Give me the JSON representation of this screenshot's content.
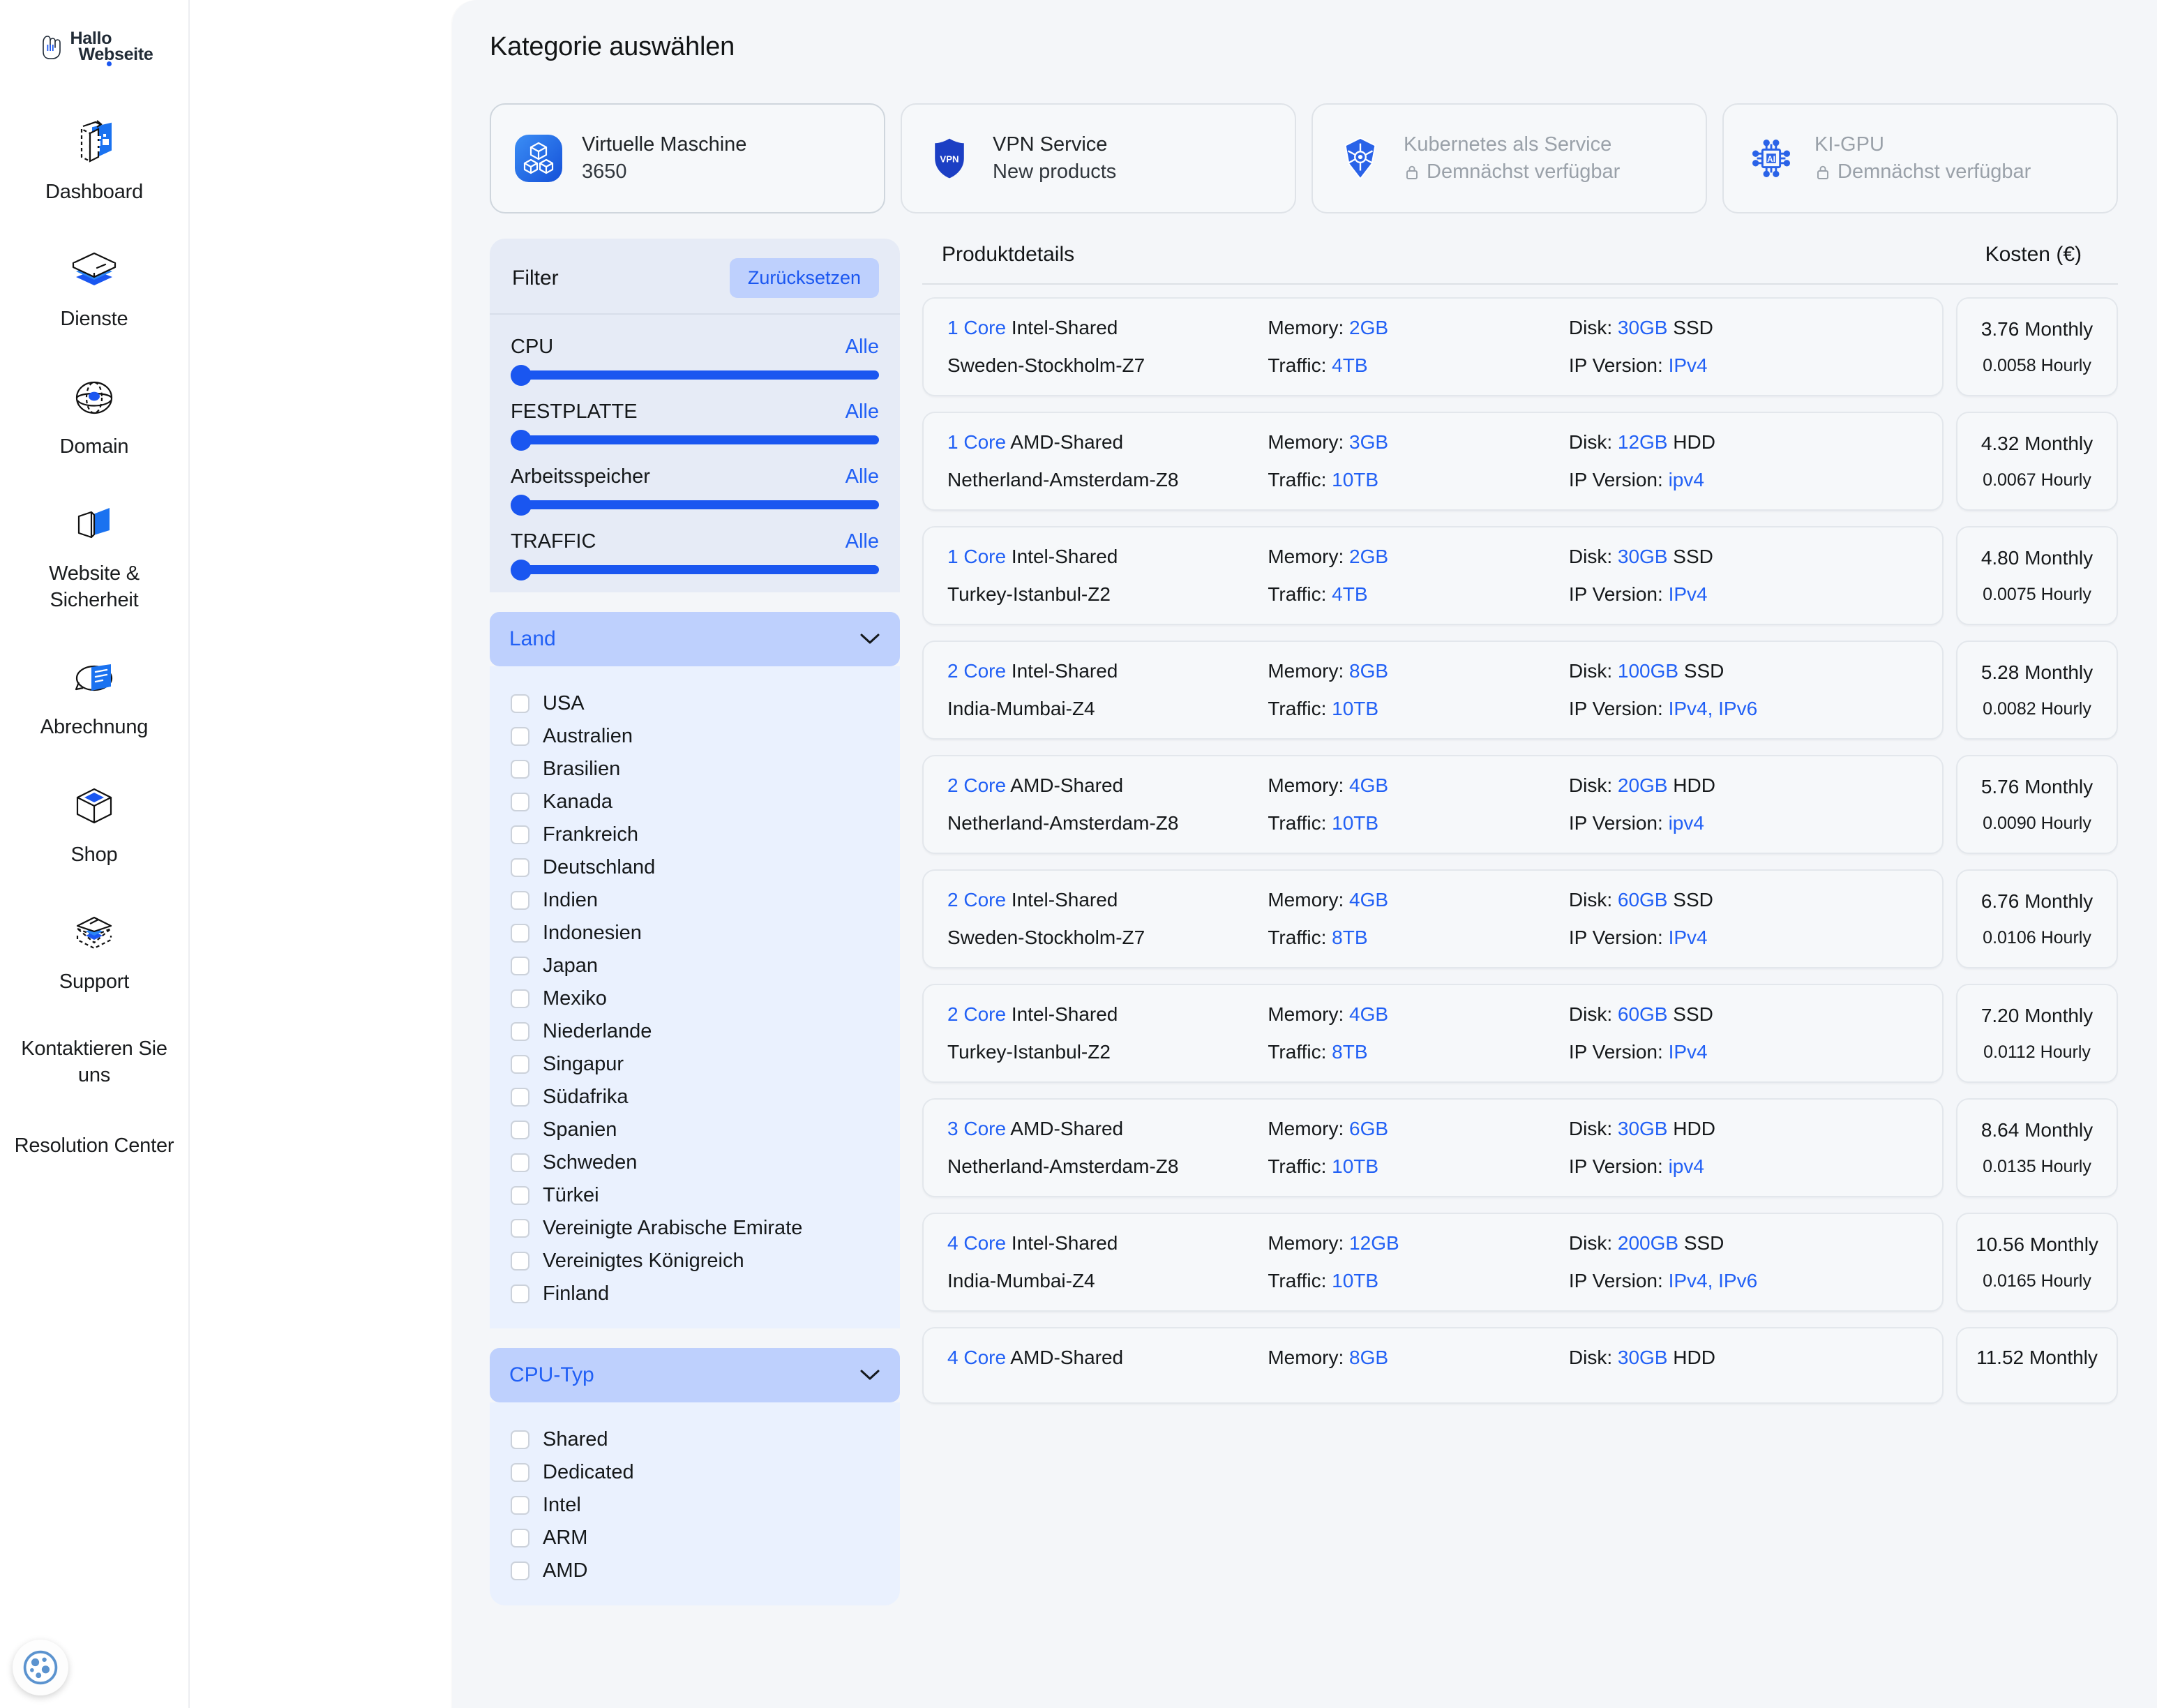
{
  "brand": {
    "line1": "Hallo",
    "line2": "Webseite"
  },
  "sidebar": {
    "items": [
      {
        "label": "Dashboard",
        "icon": "dashboard-icon"
      },
      {
        "label": "Dienste",
        "icon": "services-layers-icon"
      },
      {
        "label": "Domain",
        "icon": "globe-icon"
      },
      {
        "label": "Website & Sicherheit",
        "icon": "website-security-icon"
      },
      {
        "label": "Abrechnung",
        "icon": "billing-icon"
      },
      {
        "label": "Shop",
        "icon": "shop-box-icon"
      },
      {
        "label": "Support",
        "icon": "support-layers-icon"
      },
      {
        "label": "Kontaktieren Sie uns",
        "icon": "none"
      },
      {
        "label": "Resolution Center",
        "icon": "none"
      }
    ],
    "accessibility_button": "accessibility-icon"
  },
  "header": {
    "title": "Kategorie auswählen",
    "flag": "german-flag-icon"
  },
  "categories": [
    {
      "icon": "cubes-icon",
      "title": "Virtuelle Maschine",
      "subtitle": "3650",
      "state": "active",
      "locked": false
    },
    {
      "icon": "vpn-shield-icon",
      "title": "VPN Service",
      "subtitle": "New products",
      "state": "default",
      "locked": false
    },
    {
      "icon": "kubernetes-icon",
      "title": "Kubernetes als Service",
      "subtitle": "Demnächst verfügbar",
      "state": "disabled",
      "locked": true
    },
    {
      "icon": "ai-gpu-chip-icon",
      "title": "KI-GPU",
      "subtitle": "Demnächst verfügbar",
      "state": "disabled",
      "locked": true
    }
  ],
  "filter": {
    "title": "Filter",
    "reset_label": "Zurücksetzen",
    "sliders": [
      {
        "label": "CPU",
        "value_label": "Alle",
        "position": 0
      },
      {
        "label": "FESTPLATTE",
        "value_label": "Alle",
        "position": 0
      },
      {
        "label": "Arbeitsspeicher",
        "value_label": "Alle",
        "position": 0
      },
      {
        "label": "TRAFFIC",
        "value_label": "Alle",
        "position": 0
      }
    ],
    "country_section": {
      "title": "Land",
      "expanded": true,
      "options": [
        {
          "label": "USA",
          "checked": false
        },
        {
          "label": "Australien",
          "checked": false
        },
        {
          "label": "Brasilien",
          "checked": false
        },
        {
          "label": "Kanada",
          "checked": false
        },
        {
          "label": "Frankreich",
          "checked": false
        },
        {
          "label": "Deutschland",
          "checked": false
        },
        {
          "label": "Indien",
          "checked": false
        },
        {
          "label": "Indonesien",
          "checked": false
        },
        {
          "label": "Japan",
          "checked": false
        },
        {
          "label": "Mexiko",
          "checked": false
        },
        {
          "label": "Niederlande",
          "checked": false
        },
        {
          "label": "Singapur",
          "checked": false
        },
        {
          "label": "Südafrika",
          "checked": false
        },
        {
          "label": "Spanien",
          "checked": false
        },
        {
          "label": "Schweden",
          "checked": false
        },
        {
          "label": "Türkei",
          "checked": false
        },
        {
          "label": "Vereinigte Arabische Emirate",
          "checked": false
        },
        {
          "label": "Vereinigtes Königreich",
          "checked": false
        },
        {
          "label": "Finland",
          "checked": false
        }
      ]
    },
    "cpu_type_section": {
      "title": "CPU-Typ",
      "expanded": true,
      "options": [
        {
          "label": "Shared",
          "checked": false
        },
        {
          "label": "Dedicated",
          "checked": false
        },
        {
          "label": "Intel",
          "checked": false
        },
        {
          "label": "ARM",
          "checked": false
        },
        {
          "label": "AMD",
          "checked": false
        }
      ]
    }
  },
  "products": {
    "header_left": "Produktdetails",
    "header_right": "Kosten (€)",
    "labels": {
      "memory": "Memory:",
      "disk": "Disk:",
      "traffic": "Traffic:",
      "ip_version": "IP Version:",
      "monthly": "Monthly",
      "hourly": "Hourly"
    },
    "rows": [
      {
        "cores": "1 Core",
        "cpu": "Intel-Shared",
        "location": "Sweden-Stockholm-Z7",
        "memory": "2GB",
        "traffic": "4TB",
        "disk": "30GB",
        "disk_type": "SSD",
        "ip": "IPv4",
        "monthly": "3.76",
        "hourly": "0.0058"
      },
      {
        "cores": "1 Core",
        "cpu": "AMD-Shared",
        "location": "Netherland-Amsterdam-Z8",
        "memory": "3GB",
        "traffic": "10TB",
        "disk": "12GB",
        "disk_type": "HDD",
        "ip": "ipv4",
        "monthly": "4.32",
        "hourly": "0.0067"
      },
      {
        "cores": "1 Core",
        "cpu": "Intel-Shared",
        "location": "Turkey-Istanbul-Z2",
        "memory": "2GB",
        "traffic": "4TB",
        "disk": "30GB",
        "disk_type": "SSD",
        "ip": "IPv4",
        "monthly": "4.80",
        "hourly": "0.0075"
      },
      {
        "cores": "2 Core",
        "cpu": "Intel-Shared",
        "location": "India-Mumbai-Z4",
        "memory": "8GB",
        "traffic": "10TB",
        "disk": "100GB",
        "disk_type": "SSD",
        "ip": "IPv4, IPv6",
        "monthly": "5.28",
        "hourly": "0.0082"
      },
      {
        "cores": "2 Core",
        "cpu": "AMD-Shared",
        "location": "Netherland-Amsterdam-Z8",
        "memory": "4GB",
        "traffic": "10TB",
        "disk": "20GB",
        "disk_type": "HDD",
        "ip": "ipv4",
        "monthly": "5.76",
        "hourly": "0.0090"
      },
      {
        "cores": "2 Core",
        "cpu": "Intel-Shared",
        "location": "Sweden-Stockholm-Z7",
        "memory": "4GB",
        "traffic": "8TB",
        "disk": "60GB",
        "disk_type": "SSD",
        "ip": "IPv4",
        "monthly": "6.76",
        "hourly": "0.0106"
      },
      {
        "cores": "2 Core",
        "cpu": "Intel-Shared",
        "location": "Turkey-Istanbul-Z2",
        "memory": "4GB",
        "traffic": "8TB",
        "disk": "60GB",
        "disk_type": "SSD",
        "ip": "IPv4",
        "monthly": "7.20",
        "hourly": "0.0112"
      },
      {
        "cores": "3 Core",
        "cpu": "AMD-Shared",
        "location": "Netherland-Amsterdam-Z8",
        "memory": "6GB",
        "traffic": "10TB",
        "disk": "30GB",
        "disk_type": "HDD",
        "ip": "ipv4",
        "monthly": "8.64",
        "hourly": "0.0135"
      },
      {
        "cores": "4 Core",
        "cpu": "Intel-Shared",
        "location": "India-Mumbai-Z4",
        "memory": "12GB",
        "traffic": "10TB",
        "disk": "200GB",
        "disk_type": "SSD",
        "ip": "IPv4, IPv6",
        "monthly": "10.56",
        "hourly": "0.0165"
      },
      {
        "cores": "4 Core",
        "cpu": "AMD-Shared",
        "location": "",
        "memory": "8GB",
        "traffic": "",
        "disk": "30GB",
        "disk_type": "HDD",
        "ip": "",
        "monthly": "11.52",
        "hourly": ""
      }
    ]
  },
  "colors": {
    "accent_blue": "#1a56f0",
    "link_blue": "#2160f5",
    "panel_bg": "#f4f6f9",
    "filter_bg": "#e6ebf6",
    "option_bg": "#eaf1fe",
    "accordion_bg": "#bed0fd",
    "card_bg": "#f6f8fa"
  }
}
